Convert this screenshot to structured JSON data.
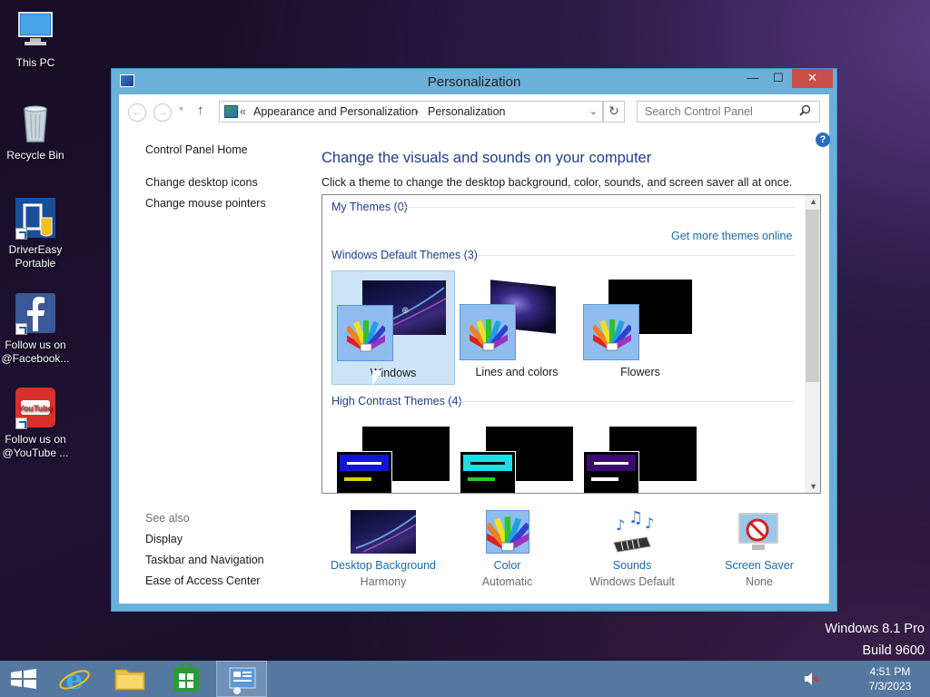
{
  "desktop": {
    "icons": [
      {
        "label": "This PC"
      },
      {
        "label": "Recycle Bin"
      },
      {
        "label": "DriverEasy Portable"
      },
      {
        "label": "Follow us on @Facebook..."
      },
      {
        "label": "Follow us on @YouTube ..."
      }
    ],
    "watermark": {
      "line1": "Windows 8.1 Pro",
      "line2": "Build 9600"
    }
  },
  "window": {
    "title": "Personalization",
    "buttons": {
      "minimize": "—",
      "maximize": "☐",
      "close": "✕"
    }
  },
  "address_bar": {
    "chevrons": "«",
    "crumbs": [
      "Appearance and Personalization",
      "Personalization"
    ],
    "separator": "›",
    "search_placeholder": "Search Control Panel"
  },
  "left_nav": {
    "home": "Control Panel Home",
    "links": [
      "Change desktop icons",
      "Change mouse pointers"
    ],
    "see_also_label": "See also",
    "see_also": [
      "Display",
      "Taskbar and Navigation",
      "Ease of Access Center"
    ]
  },
  "main": {
    "heading": "Change the visuals and sounds on your computer",
    "subheading": "Click a theme to change the desktop background, color, sounds, and screen saver all at once.",
    "groups": {
      "my_themes": "My Themes (0)",
      "get_more": "Get more themes online",
      "default_themes": "Windows Default Themes (3)",
      "high_contrast": "High Contrast Themes (4)"
    },
    "themes": [
      {
        "name": "Windows",
        "selected": true
      },
      {
        "name": "Lines and colors",
        "selected": false
      },
      {
        "name": "Flowers",
        "selected": false
      }
    ],
    "high_contrast_colors": [
      {
        "bar": "#1414d8",
        "line": "#e0d000"
      },
      {
        "bar": "#18e0e8",
        "line": "#20d020"
      },
      {
        "bar": "#3a0a6e",
        "line": "#ffffff"
      }
    ]
  },
  "bottom_settings": [
    {
      "label": "Desktop Background",
      "value": "Harmony"
    },
    {
      "label": "Color",
      "value": "Automatic"
    },
    {
      "label": "Sounds",
      "value": "Windows Default"
    },
    {
      "label": "Screen Saver",
      "value": "None"
    }
  ],
  "taskbar": {
    "clock_time": "4:51 PM",
    "clock_date": "7/3/2023"
  },
  "colors": {
    "accent": "#6ab0d8",
    "link": "#1c6ba8",
    "heading": "#1e3d8a",
    "close": "#c7504a",
    "taskbar": "#5578a0"
  }
}
